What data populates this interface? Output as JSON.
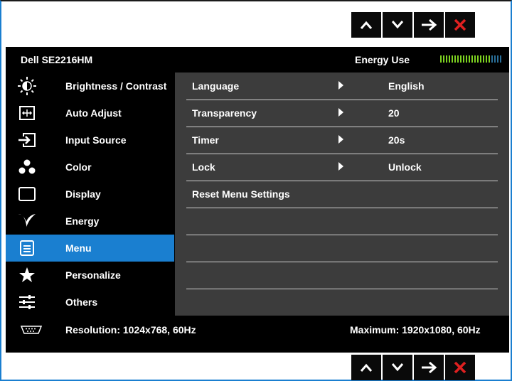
{
  "nav": {
    "buttons": [
      {
        "name": "up-button",
        "icon": "chevron-up-icon"
      },
      {
        "name": "down-button",
        "icon": "chevron-down-icon"
      },
      {
        "name": "enter-button",
        "icon": "arrow-right-icon"
      },
      {
        "name": "exit-button",
        "icon": "close-icon",
        "color": "#e02020"
      }
    ]
  },
  "header": {
    "model": "Dell SE2216HM",
    "energy_label": "Energy Use",
    "energy_level": 0.8,
    "energy_colors": {
      "on": "#7ed321",
      "off": "#2a6f9a"
    }
  },
  "sidebar": {
    "items": [
      {
        "label": "Brightness / Contrast",
        "icon": "brightness-icon"
      },
      {
        "label": "Auto Adjust",
        "icon": "auto-adjust-icon"
      },
      {
        "label": "Input Source",
        "icon": "input-source-icon"
      },
      {
        "label": "Color",
        "icon": "color-icon"
      },
      {
        "label": "Display",
        "icon": "display-icon"
      },
      {
        "label": "Energy",
        "icon": "energy-leaf-icon"
      },
      {
        "label": "Menu",
        "icon": "menu-icon",
        "active": true
      },
      {
        "label": "Personalize",
        "icon": "star-icon"
      },
      {
        "label": "Others",
        "icon": "sliders-icon"
      }
    ]
  },
  "menu": {
    "rows": [
      {
        "label": "Language",
        "value": "English"
      },
      {
        "label": "Transparency",
        "value": "20"
      },
      {
        "label": "Timer",
        "value": "20s"
      },
      {
        "label": "Lock",
        "value": "Unlock"
      },
      {
        "label": "Reset Menu Settings",
        "value": ""
      },
      {
        "label": "",
        "value": ""
      },
      {
        "label": "",
        "value": ""
      },
      {
        "label": "",
        "value": ""
      }
    ]
  },
  "status": {
    "input_icon": "vga-connector-icon",
    "resolution": "Resolution: 1024x768, 60Hz",
    "maximum": "Maximum: 1920x1080, 60Hz"
  },
  "colors": {
    "accent": "#1a7fd0",
    "panel": "#3c3c3c",
    "exit": "#e02020"
  }
}
